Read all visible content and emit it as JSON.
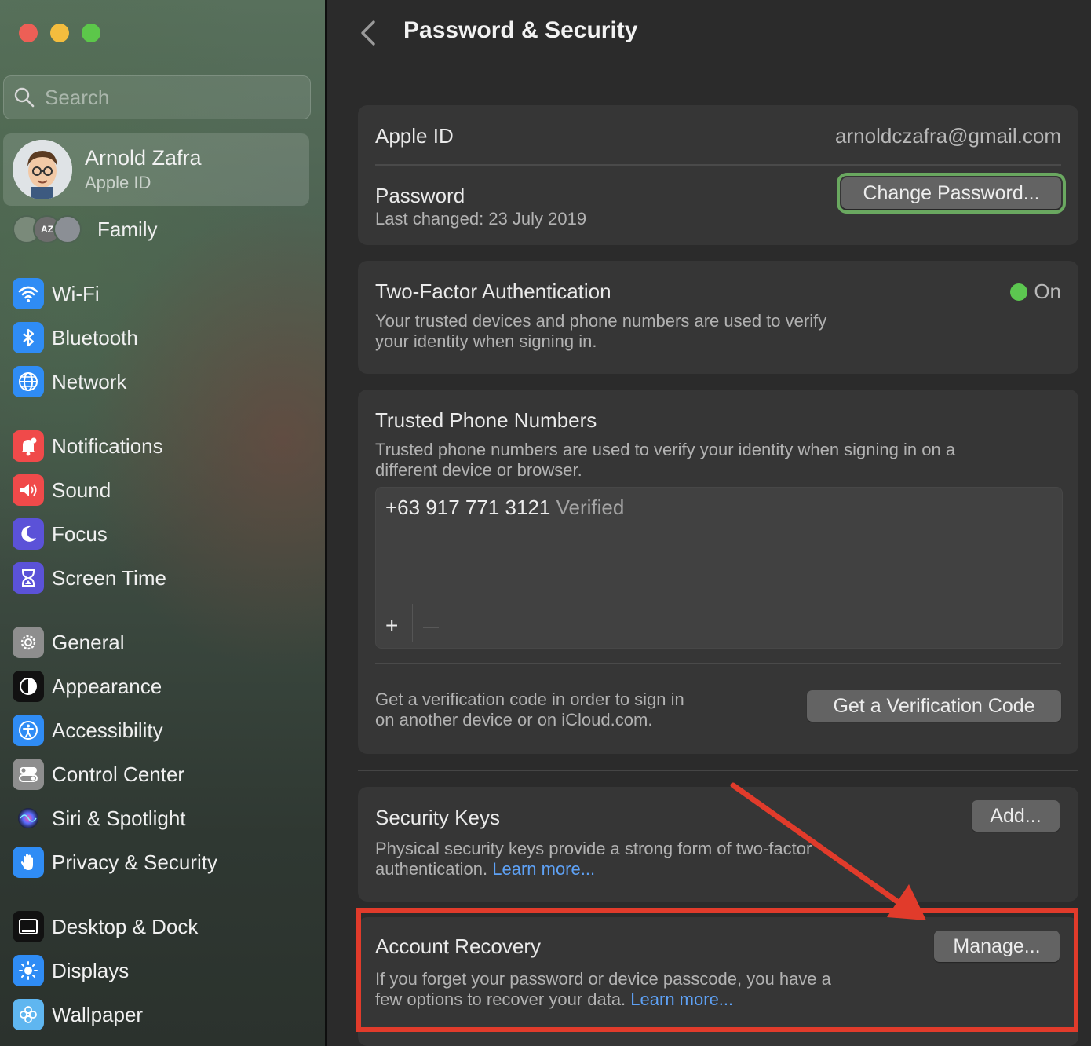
{
  "window": {
    "title": "Password & Security",
    "controls": [
      "close",
      "minimize",
      "zoom"
    ]
  },
  "sidebar": {
    "search_placeholder": "Search",
    "account": {
      "name": "Arnold Zafra",
      "subtitle": "Apple ID"
    },
    "family": {
      "label": "Family",
      "avatar_initials": "AZ"
    },
    "items": [
      {
        "label": "Wi-Fi",
        "icon": "wifi-icon",
        "color": "#2f8cf5"
      },
      {
        "label": "Bluetooth",
        "icon": "bluetooth-icon",
        "color": "#2f8cf5"
      },
      {
        "label": "Network",
        "icon": "globe-icon",
        "color": "#2f8cf5"
      },
      {
        "label": "Notifications",
        "icon": "bell-icon",
        "color": "#f04a4a"
      },
      {
        "label": "Sound",
        "icon": "speaker-icon",
        "color": "#f04a4a"
      },
      {
        "label": "Focus",
        "icon": "moon-icon",
        "color": "#5b52d8"
      },
      {
        "label": "Screen Time",
        "icon": "hourglass-icon",
        "color": "#5b52d8"
      },
      {
        "label": "General",
        "icon": "gear-icon",
        "color": "#8e8e8e"
      },
      {
        "label": "Appearance",
        "icon": "appearance-icon",
        "color": "#111111"
      },
      {
        "label": "Accessibility",
        "icon": "accessibility-icon",
        "color": "#2f8cf5"
      },
      {
        "label": "Control Center",
        "icon": "toggles-icon",
        "color": "#8e8e8e"
      },
      {
        "label": "Siri & Spotlight",
        "icon": "siri-icon",
        "color": "#2a2a3a"
      },
      {
        "label": "Privacy & Security",
        "icon": "hand-icon",
        "color": "#2f8cf5"
      },
      {
        "label": "Desktop & Dock",
        "icon": "dock-icon",
        "color": "#111111"
      },
      {
        "label": "Displays",
        "icon": "sun-icon",
        "color": "#2f8cf5"
      },
      {
        "label": "Wallpaper",
        "icon": "flower-icon",
        "color": "#5fb6f0"
      }
    ]
  },
  "main": {
    "title": "Password & Security",
    "apple_id": {
      "label": "Apple ID",
      "value": "arnoldczafra@gmail.com"
    },
    "password": {
      "label": "Password",
      "last_changed": "Last changed: 23 July 2019",
      "button": "Change Password..."
    },
    "two_factor": {
      "label": "Two-Factor Authentication",
      "status": "On",
      "status_color": "#5cc750",
      "description_line1": "Your trusted devices and phone numbers are used to verify",
      "description_line2": "your identity when signing in."
    },
    "trusted_phones": {
      "label": "Trusted Phone Numbers",
      "description_line1": "Trusted phone numbers are used to verify your identity when signing in on a",
      "description_line2": "different device or browser.",
      "numbers": [
        {
          "number": "+63 917 771 3121",
          "status": "Verified"
        }
      ],
      "add": "+",
      "remove": "—",
      "verification_line1": "Get a verification code in order to sign in",
      "verification_line2": "on another device or on iCloud.com.",
      "verification_button": "Get a Verification Code"
    },
    "security_keys": {
      "label": "Security Keys",
      "description_line1": "Physical security keys provide a strong form of two-factor",
      "description_line2": "authentication.",
      "link": "Learn more...",
      "button": "Add..."
    },
    "account_recovery": {
      "label": "Account Recovery",
      "description_line1": "If you forget your password or device passcode, you have a",
      "description_line2": "few options to recover your data.",
      "link": "Learn more...",
      "button": "Manage..."
    }
  },
  "annotation": {
    "highlight_color": "#e13b2b"
  }
}
